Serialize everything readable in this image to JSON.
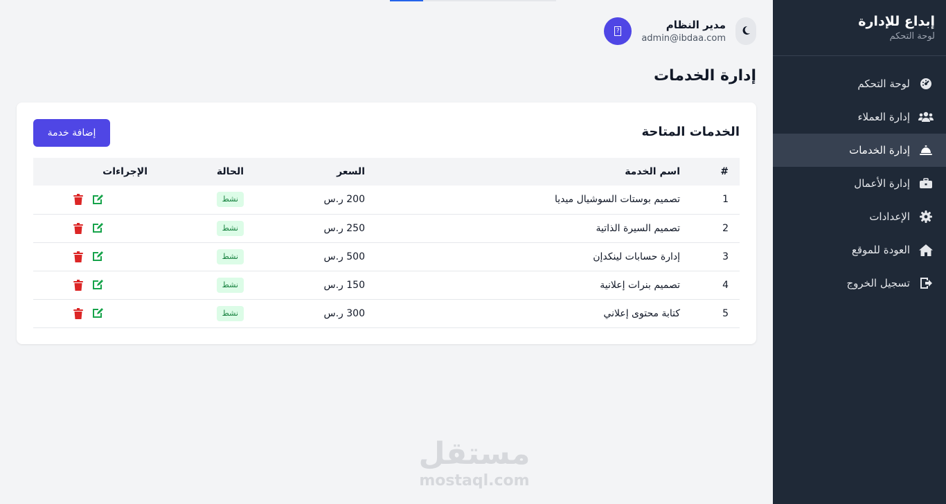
{
  "sidebar": {
    "brand_title": "إبداع للإدارة",
    "brand_subtitle": "لوحة التحكم",
    "items": [
      {
        "label": "لوحة التحكم",
        "icon": "gauge-icon",
        "active": false
      },
      {
        "label": "إدارة العملاء",
        "icon": "users-icon",
        "active": false
      },
      {
        "label": "إدارة الخدمات",
        "icon": "bell-service-icon",
        "active": true
      },
      {
        "label": "إدارة الأعمال",
        "icon": "briefcase-icon",
        "active": false
      },
      {
        "label": "الإعدادات",
        "icon": "gear-icon",
        "active": false
      },
      {
        "label": "العودة للموقع",
        "icon": "home-icon",
        "active": false
      },
      {
        "label": "تسجيل الخروج",
        "icon": "logout-icon",
        "active": false
      }
    ]
  },
  "header": {
    "user_name": "مدير النظام",
    "user_email": "admin@ibdaa.com"
  },
  "page_title": "إدارة الخدمات",
  "card": {
    "title": "الخدمات المتاحة",
    "add_label": "إضافة خدمة"
  },
  "table": {
    "headers": {
      "num": "#",
      "name": "اسم الخدمة",
      "price": "السعر",
      "status": "الحالة",
      "actions": "الإجراءات"
    },
    "rows": [
      {
        "num": "1",
        "name": "تصميم بوستات السوشيال ميديا",
        "price": "200 ر.س",
        "status": "نشط"
      },
      {
        "num": "2",
        "name": "تصميم السيرة الذاتية",
        "price": "250 ر.س",
        "status": "نشط"
      },
      {
        "num": "3",
        "name": "إدارة حسابات لينكدإن",
        "price": "500 ر.س",
        "status": "نشط"
      },
      {
        "num": "4",
        "name": "تصميم بنرات إعلانية",
        "price": "150 ر.س",
        "status": "نشط"
      },
      {
        "num": "5",
        "name": "كتابة محتوى إعلاني",
        "price": "300 ر.س",
        "status": "نشط"
      }
    ]
  },
  "watermark": {
    "ar": "مستقل",
    "en": "mostaql.com"
  },
  "colors": {
    "sidebar": "#1f2937",
    "accent": "#4f46e5",
    "edit": "#16a34a",
    "delete": "#dc2626",
    "badge_bg": "#dcfce7",
    "badge_text": "#15803d"
  }
}
